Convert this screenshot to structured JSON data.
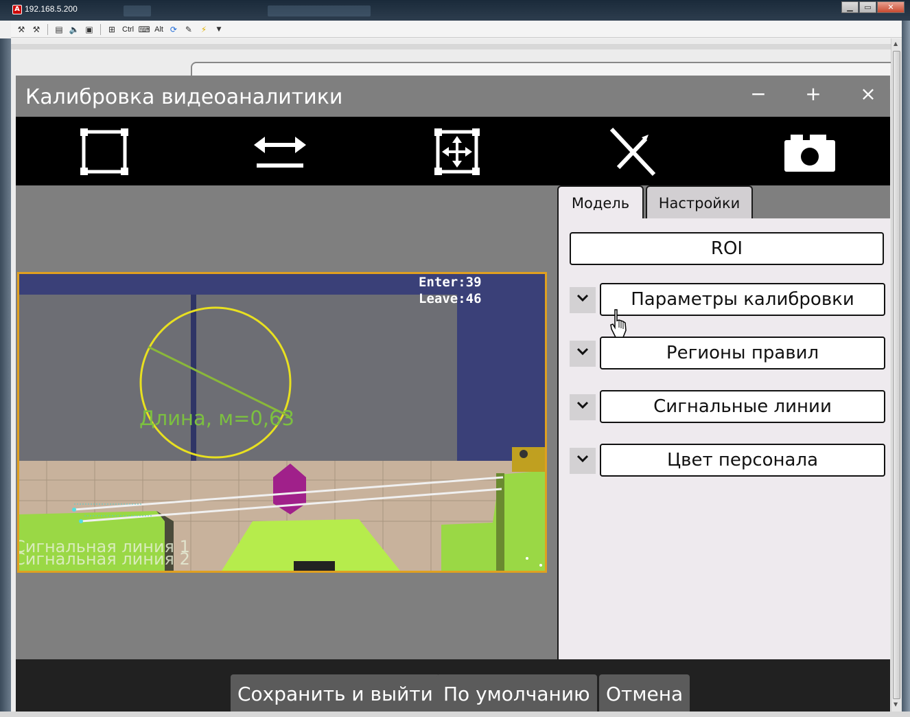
{
  "remote_window": {
    "title": "192.168.5.200",
    "toolbar": {
      "ctrl_label": "Ctrl",
      "alt_label": "Alt"
    }
  },
  "dialog": {
    "title": "Калибровка видеоаналитики",
    "minimize_label": "−",
    "maximize_label": "+",
    "close_label": "×"
  },
  "toolbar_tools": [
    "rectangle-tool",
    "horizontal-line-tool",
    "move-tool",
    "delete-tool",
    "snapshot-tool"
  ],
  "video": {
    "counter_enter": "Enter:39",
    "counter_leave": "Leave:46",
    "measure_label": "Длина, м=0,63",
    "line1_label": "Сигнальная линия 1",
    "line2_label": "Сигнальная линия 2",
    "colors": {
      "frame": "#e0a020",
      "circle": "#e8e020",
      "measure": "#7cc040",
      "marker": "#a0208a",
      "lines": "#f0f0f0"
    }
  },
  "tabs": [
    {
      "label": "Модель",
      "active": true
    },
    {
      "label": "Настройки",
      "active": false
    }
  ],
  "panel": {
    "roi_label": "ROI",
    "sections": [
      {
        "label": "Параметры калибровки"
      },
      {
        "label": "Регионы правил"
      },
      {
        "label": "Сигнальные линии"
      },
      {
        "label": "Цвет персонала"
      }
    ]
  },
  "footer": {
    "save_label": "Сохранить и выйти",
    "default_label": "По умолчанию",
    "cancel_label": "Отмена"
  }
}
